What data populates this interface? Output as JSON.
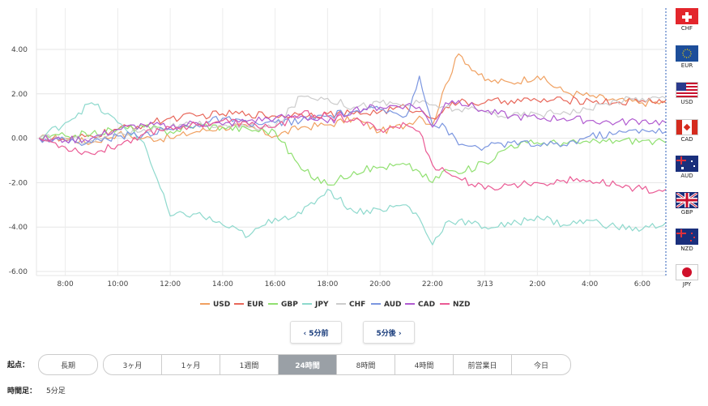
{
  "chart_data": {
    "type": "line",
    "ylim": [
      -6,
      5
    ],
    "y_ticks": [
      "4.00",
      "2.00",
      "0.00",
      "-2.00",
      "-4.00",
      "-6.00"
    ],
    "y_tick_values": [
      4,
      2,
      0,
      -2,
      -4,
      -6
    ],
    "x_ticks": [
      "8:00",
      "10:00",
      "12:00",
      "14:00",
      "16:00",
      "18:00",
      "20:00",
      "22:00",
      "3/13",
      "2:00",
      "4:00",
      "6:00"
    ],
    "x_tick_hours": [
      8,
      10,
      12,
      14,
      16,
      18,
      20,
      22,
      24,
      26,
      28,
      30
    ],
    "x_range_hours": [
      6.9,
      30.9
    ],
    "grid": true,
    "legend_position": "bottom",
    "x": [
      7.0,
      8.0,
      9.0,
      10.0,
      11.0,
      12.0,
      13.0,
      14.0,
      15.0,
      16.0,
      17.0,
      18.0,
      19.0,
      20.0,
      21.0,
      21.5,
      22.0,
      22.5,
      23.0,
      24.0,
      25.0,
      26.0,
      27.0,
      28.0,
      29.0,
      30.0,
      30.9
    ],
    "series": [
      {
        "name": "USD",
        "color": "#f0a060",
        "values": [
          0.0,
          0.0,
          -0.2,
          0.2,
          0.0,
          0.0,
          0.3,
          0.5,
          0.5,
          0.1,
          0.5,
          0.6,
          0.9,
          0.3,
          0.6,
          1.0,
          0.6,
          2.4,
          3.8,
          2.6,
          2.5,
          2.8,
          2.1,
          1.9,
          1.7,
          1.6,
          1.6
        ]
      },
      {
        "name": "EUR",
        "color": "#e8675a",
        "values": [
          0.0,
          -0.1,
          0.1,
          0.4,
          0.6,
          0.9,
          1.0,
          1.1,
          1.1,
          1.0,
          1.1,
          1.1,
          1.1,
          1.2,
          1.4,
          1.2,
          0.9,
          1.4,
          1.6,
          1.6,
          1.7,
          1.7,
          1.7,
          1.7,
          1.6,
          1.7,
          1.7
        ]
      },
      {
        "name": "GBP",
        "color": "#90e070",
        "values": [
          0.0,
          0.1,
          0.2,
          0.4,
          0.5,
          0.3,
          0.6,
          0.5,
          0.4,
          0.3,
          -1.4,
          -2.1,
          -1.5,
          -1.3,
          -1.2,
          -1.5,
          -2.0,
          -1.4,
          -1.6,
          -1.1,
          -0.3,
          -0.2,
          -0.2,
          -0.2,
          -0.1,
          -0.1,
          -0.2
        ]
      },
      {
        "name": "JPY",
        "color": "#8ed9cd",
        "values": [
          0.0,
          0.7,
          1.6,
          0.7,
          -0.2,
          -3.5,
          -3.4,
          -3.9,
          -4.4,
          -3.6,
          -3.4,
          -2.3,
          -3.3,
          -3.2,
          -3.0,
          -3.6,
          -4.8,
          -3.8,
          -3.7,
          -4.0,
          -3.9,
          -3.5,
          -3.9,
          -3.7,
          -4.0,
          -4.1,
          -3.8
        ]
      },
      {
        "name": "CHF",
        "color": "#cccccc",
        "values": [
          0.0,
          0.0,
          -0.1,
          0.2,
          0.4,
          0.5,
          0.6,
          0.6,
          0.5,
          0.5,
          1.9,
          1.8,
          1.4,
          1.6,
          1.5,
          1.6,
          1.5,
          1.4,
          1.3,
          1.2,
          1.0,
          1.1,
          1.2,
          1.3,
          1.7,
          1.8,
          1.8
        ]
      },
      {
        "name": "AUD",
        "color": "#7b96e0",
        "values": [
          0.0,
          -0.1,
          -0.2,
          0.1,
          0.2,
          0.4,
          0.6,
          0.9,
          0.6,
          0.7,
          0.8,
          1.0,
          1.2,
          1.3,
          1.0,
          2.8,
          0.6,
          0.5,
          -0.3,
          -0.4,
          -0.2,
          -0.3,
          -0.3,
          0.1,
          0.2,
          0.4,
          0.3
        ]
      },
      {
        "name": "CAD",
        "color": "#b05ad0",
        "values": [
          0.0,
          -0.1,
          0.0,
          0.4,
          0.6,
          0.5,
          0.7,
          0.6,
          0.8,
          0.9,
          1.0,
          0.7,
          1.3,
          1.4,
          1.5,
          1.4,
          0.5,
          1.6,
          1.7,
          1.2,
          1.0,
          0.9,
          0.9,
          0.8,
          0.7,
          0.8,
          0.7
        ]
      },
      {
        "name": "NZD",
        "color": "#ea5a94",
        "values": [
          0.0,
          -0.4,
          -0.7,
          -0.3,
          0.2,
          0.5,
          0.6,
          0.8,
          0.6,
          0.5,
          1.1,
          1.0,
          0.8,
          0.4,
          0.6,
          0.3,
          -1.2,
          -1.5,
          -1.8,
          -2.3,
          -2.1,
          -2.0,
          -1.9,
          -1.9,
          -2.1,
          -2.3,
          -2.3
        ]
      }
    ]
  },
  "flags": [
    {
      "code": "CHF",
      "icon": "swiss-flag-icon"
    },
    {
      "code": "EUR",
      "icon": "eu-flag-icon"
    },
    {
      "code": "USD",
      "icon": "us-flag-icon"
    },
    {
      "code": "CAD",
      "icon": "canada-flag-icon"
    },
    {
      "code": "AUD",
      "icon": "australia-flag-icon"
    },
    {
      "code": "GBP",
      "icon": "uk-flag-icon"
    },
    {
      "code": "NZD",
      "icon": "nz-flag-icon"
    },
    {
      "code": "JPY",
      "icon": "japan-flag-icon"
    }
  ],
  "nav": {
    "prev": "‹ 5分前",
    "next": "5分後 ›"
  },
  "range": {
    "label": "起点：",
    "long_btn": "長期",
    "options": [
      "3ヶ月",
      "1ヶ月",
      "1週間",
      "24時間",
      "8時間",
      "4時間",
      "前営業日",
      "今日"
    ],
    "selected": "24時間"
  },
  "interval": {
    "label": "時間足：",
    "value": "5分足"
  },
  "colors": {
    "accent_nav": "#1a3d7c",
    "active_seg": "#9aa0a6",
    "divider": "#2c5fb8"
  }
}
